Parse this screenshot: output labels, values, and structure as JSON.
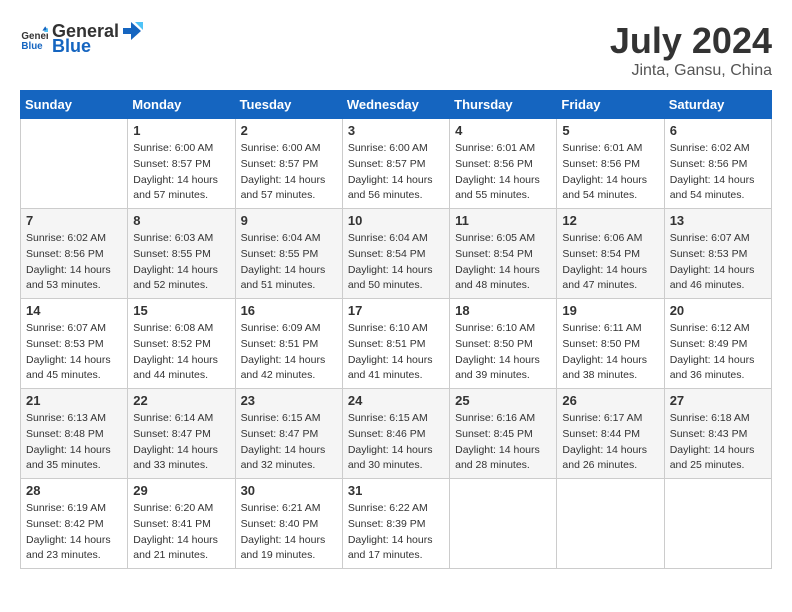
{
  "header": {
    "logo_general": "General",
    "logo_blue": "Blue",
    "month_title": "July 2024",
    "location": "Jinta, Gansu, China"
  },
  "calendar": {
    "days_of_week": [
      "Sunday",
      "Monday",
      "Tuesday",
      "Wednesday",
      "Thursday",
      "Friday",
      "Saturday"
    ],
    "weeks": [
      [
        {
          "day": "",
          "sunrise": "",
          "sunset": "",
          "daylight": ""
        },
        {
          "day": "1",
          "sunrise": "6:00 AM",
          "sunset": "8:57 PM",
          "daylight": "14 hours and 57 minutes."
        },
        {
          "day": "2",
          "sunrise": "6:00 AM",
          "sunset": "8:57 PM",
          "daylight": "14 hours and 57 minutes."
        },
        {
          "day": "3",
          "sunrise": "6:00 AM",
          "sunset": "8:57 PM",
          "daylight": "14 hours and 56 minutes."
        },
        {
          "day": "4",
          "sunrise": "6:01 AM",
          "sunset": "8:56 PM",
          "daylight": "14 hours and 55 minutes."
        },
        {
          "day": "5",
          "sunrise": "6:01 AM",
          "sunset": "8:56 PM",
          "daylight": "14 hours and 54 minutes."
        },
        {
          "day": "6",
          "sunrise": "6:02 AM",
          "sunset": "8:56 PM",
          "daylight": "14 hours and 54 minutes."
        }
      ],
      [
        {
          "day": "7",
          "sunrise": "6:02 AM",
          "sunset": "8:56 PM",
          "daylight": "14 hours and 53 minutes."
        },
        {
          "day": "8",
          "sunrise": "6:03 AM",
          "sunset": "8:55 PM",
          "daylight": "14 hours and 52 minutes."
        },
        {
          "day": "9",
          "sunrise": "6:04 AM",
          "sunset": "8:55 PM",
          "daylight": "14 hours and 51 minutes."
        },
        {
          "day": "10",
          "sunrise": "6:04 AM",
          "sunset": "8:54 PM",
          "daylight": "14 hours and 50 minutes."
        },
        {
          "day": "11",
          "sunrise": "6:05 AM",
          "sunset": "8:54 PM",
          "daylight": "14 hours and 48 minutes."
        },
        {
          "day": "12",
          "sunrise": "6:06 AM",
          "sunset": "8:54 PM",
          "daylight": "14 hours and 47 minutes."
        },
        {
          "day": "13",
          "sunrise": "6:07 AM",
          "sunset": "8:53 PM",
          "daylight": "14 hours and 46 minutes."
        }
      ],
      [
        {
          "day": "14",
          "sunrise": "6:07 AM",
          "sunset": "8:53 PM",
          "daylight": "14 hours and 45 minutes."
        },
        {
          "day": "15",
          "sunrise": "6:08 AM",
          "sunset": "8:52 PM",
          "daylight": "14 hours and 44 minutes."
        },
        {
          "day": "16",
          "sunrise": "6:09 AM",
          "sunset": "8:51 PM",
          "daylight": "14 hours and 42 minutes."
        },
        {
          "day": "17",
          "sunrise": "6:10 AM",
          "sunset": "8:51 PM",
          "daylight": "14 hours and 41 minutes."
        },
        {
          "day": "18",
          "sunrise": "6:10 AM",
          "sunset": "8:50 PM",
          "daylight": "14 hours and 39 minutes."
        },
        {
          "day": "19",
          "sunrise": "6:11 AM",
          "sunset": "8:50 PM",
          "daylight": "14 hours and 38 minutes."
        },
        {
          "day": "20",
          "sunrise": "6:12 AM",
          "sunset": "8:49 PM",
          "daylight": "14 hours and 36 minutes."
        }
      ],
      [
        {
          "day": "21",
          "sunrise": "6:13 AM",
          "sunset": "8:48 PM",
          "daylight": "14 hours and 35 minutes."
        },
        {
          "day": "22",
          "sunrise": "6:14 AM",
          "sunset": "8:47 PM",
          "daylight": "14 hours and 33 minutes."
        },
        {
          "day": "23",
          "sunrise": "6:15 AM",
          "sunset": "8:47 PM",
          "daylight": "14 hours and 32 minutes."
        },
        {
          "day": "24",
          "sunrise": "6:15 AM",
          "sunset": "8:46 PM",
          "daylight": "14 hours and 30 minutes."
        },
        {
          "day": "25",
          "sunrise": "6:16 AM",
          "sunset": "8:45 PM",
          "daylight": "14 hours and 28 minutes."
        },
        {
          "day": "26",
          "sunrise": "6:17 AM",
          "sunset": "8:44 PM",
          "daylight": "14 hours and 26 minutes."
        },
        {
          "day": "27",
          "sunrise": "6:18 AM",
          "sunset": "8:43 PM",
          "daylight": "14 hours and 25 minutes."
        }
      ],
      [
        {
          "day": "28",
          "sunrise": "6:19 AM",
          "sunset": "8:42 PM",
          "daylight": "14 hours and 23 minutes."
        },
        {
          "day": "29",
          "sunrise": "6:20 AM",
          "sunset": "8:41 PM",
          "daylight": "14 hours and 21 minutes."
        },
        {
          "day": "30",
          "sunrise": "6:21 AM",
          "sunset": "8:40 PM",
          "daylight": "14 hours and 19 minutes."
        },
        {
          "day": "31",
          "sunrise": "6:22 AM",
          "sunset": "8:39 PM",
          "daylight": "14 hours and 17 minutes."
        },
        {
          "day": "",
          "sunrise": "",
          "sunset": "",
          "daylight": ""
        },
        {
          "day": "",
          "sunrise": "",
          "sunset": "",
          "daylight": ""
        },
        {
          "day": "",
          "sunrise": "",
          "sunset": "",
          "daylight": ""
        }
      ]
    ]
  }
}
